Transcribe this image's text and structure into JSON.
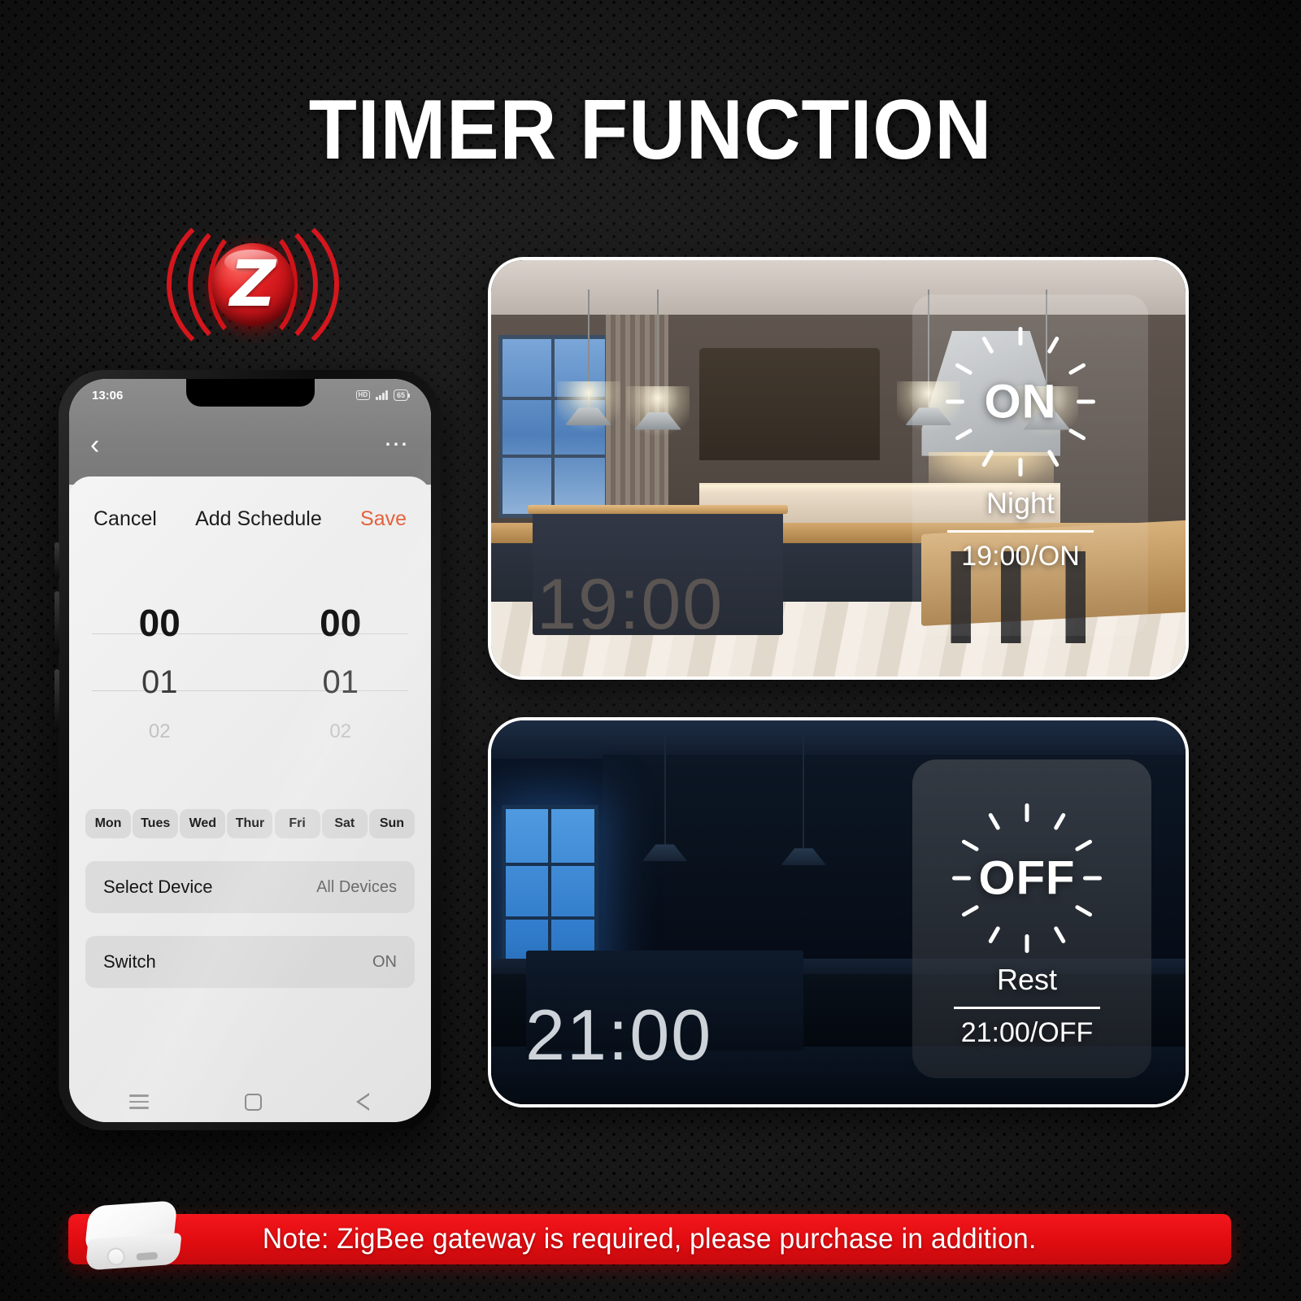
{
  "page": {
    "title": "TIMER FUNCTION",
    "background_color": "#181818",
    "accent_red": "#e00c10"
  },
  "zigbee_badge": {
    "icon": "zigbee-signal-icon",
    "letter": "Z",
    "color": "#d4161d"
  },
  "phone": {
    "status_bar": {
      "time": "13:06",
      "hd_icon": "hd-icon",
      "signal_icon": "signal-bars-icon",
      "battery_level": "65"
    },
    "appbar": {
      "back_icon": "chevron-left-icon",
      "more_icon": "more-options-icon"
    },
    "sheet": {
      "cancel_label": "Cancel",
      "title": "Add Schedule",
      "save_label": "Save",
      "save_color": "#e2613b"
    },
    "time_picker": {
      "hour": {
        "selected": "00",
        "next": "01",
        "far": "02"
      },
      "minute": {
        "selected": "00",
        "next": "01",
        "far": "02"
      }
    },
    "days": [
      "Mon",
      "Tues",
      "Wed",
      "Thur",
      "Fri",
      "Sat",
      "Sun"
    ],
    "rows": [
      {
        "label": "Select Device",
        "value": "All Devices"
      },
      {
        "label": "Switch",
        "value": "ON"
      }
    ],
    "nav_bar": {
      "menu_icon": "menu-icon",
      "home_icon": "home-square-icon",
      "back_icon": "back-triangle-icon"
    }
  },
  "scenes": [
    {
      "id": "day",
      "time_label": "19:00",
      "time_color": "#5a5553",
      "overlay": {
        "state": "ON",
        "name": "Night",
        "schedule": "19:00/ON",
        "burst_icon": "burst-rays-icon"
      }
    },
    {
      "id": "night",
      "time_label": "21:00",
      "time_color": "#cdd3d8",
      "overlay": {
        "state": "OFF",
        "name": "Rest",
        "schedule": "21:00/OFF",
        "burst_icon": "burst-rays-icon"
      }
    }
  ],
  "note": {
    "text": "Note: ZigBee gateway is required, please purchase in addition.",
    "device_icon": "zigbee-gateway-hub-icon",
    "background": "#e00c10"
  }
}
